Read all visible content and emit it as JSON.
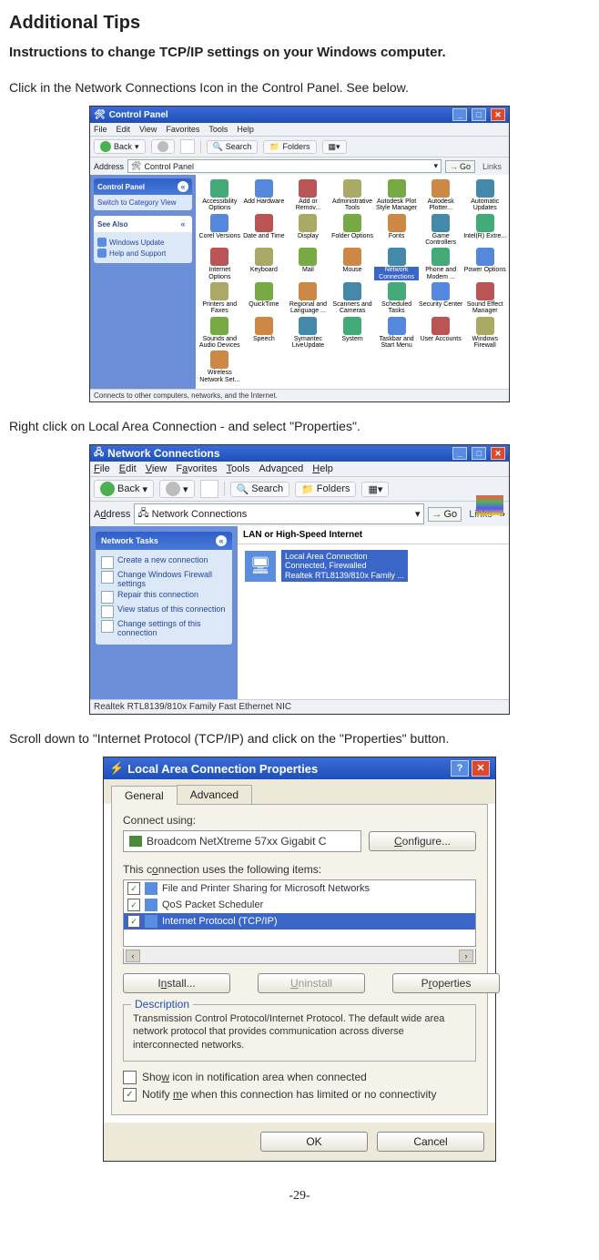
{
  "page": {
    "title": "Additional Tips",
    "subtitle": "Instructions to change TCP/IP settings on your Windows computer.",
    "step1": "Click in the Network Connections Icon in the Control Panel. See below.",
    "step2": "Right click on Local Area Connection - and select \"Properties\".",
    "step3": "Scroll down to \"Internet Protocol (TCP/IP) and click on the \"Properties\" button.",
    "page_number": "-29-"
  },
  "control_panel": {
    "title": "Control Panel",
    "menus": {
      "file": "File",
      "edit": "Edit",
      "view": "View",
      "favorites": "Favorites",
      "tools": "Tools",
      "help": "Help"
    },
    "toolbar": {
      "back": "Back",
      "search": "Search",
      "folders": "Folders"
    },
    "address_label": "Address",
    "address_value": "Control Panel",
    "go": "Go",
    "links": "Links",
    "side": {
      "header": "Control Panel",
      "switch": "Switch to Category View",
      "see_also": "See Also",
      "win_update": "Windows Update",
      "help": "Help and Support"
    },
    "items": [
      [
        "Accessibility Options",
        "Add Hardware",
        "Add or Remov...",
        "Administrative Tools",
        "Autodesk Plot Style Manager",
        "Autodesk Plotter...",
        "Automatic Updates"
      ],
      [
        "Corel Versions",
        "Date and Time",
        "Display",
        "Folder Options",
        "Fonts",
        "Game Controllers",
        "Intel(R) Extre..."
      ],
      [
        "Internet Options",
        "Keyboard",
        "Mail",
        "Mouse",
        "Network Connections",
        "Phone and Modem ...",
        "Power Options"
      ],
      [
        "Printers and Faxes",
        "QuickTime",
        "Regional and Language ...",
        "Scanners and Cameras",
        "Scheduled Tasks",
        "Security Center",
        "Sound Effect Manager"
      ],
      [
        "Sounds and Audio Devices",
        "Speech",
        "Symantec LiveUpdate",
        "System",
        "Taskbar and Start Menu",
        "User Accounts",
        "Windows Firewall"
      ],
      [
        "Wireless Network Set...",
        "",
        "",
        "",
        "",
        "",
        ""
      ]
    ],
    "selected": "Network Connections",
    "status": "Connects to other computers, networks, and the Internet."
  },
  "network_connections": {
    "title": "Network Connections",
    "menus": {
      "file": "File",
      "edit": "Edit",
      "view": "View",
      "favorites": "Favorites",
      "tools": "Tools",
      "advanced": "Advanced",
      "help": "Help"
    },
    "toolbar": {
      "back": "Back",
      "search": "Search",
      "folders": "Folders"
    },
    "address_label": "Address",
    "address_value": "Network Connections",
    "go": "Go",
    "links": "Links",
    "tasks_header": "Network Tasks",
    "tasks": [
      "Create a new connection",
      "Change Windows Firewall settings",
      "Repair this connection",
      "View status of this connection",
      "Change settings of this connection"
    ],
    "group": "LAN or High-Speed Internet",
    "conn_name": "Local Area Connection",
    "conn_status": "Connected, Firewalled",
    "conn_device": "Realtek RTL8139/810x Family ...",
    "status": "Realtek RTL8139/810x Family Fast Ethernet NIC"
  },
  "lac_properties": {
    "title": "Local Area Connection Properties",
    "tabs": {
      "general": "General",
      "advanced": "Advanced"
    },
    "connect_using": "Connect using:",
    "adapter": "Broadcom NetXtreme 57xx Gigabit C",
    "configure": "Configure...",
    "items_label": "This connection uses the following items:",
    "items": [
      "File and Printer Sharing for Microsoft Networks",
      "QoS Packet Scheduler",
      "Internet Protocol (TCP/IP)"
    ],
    "install": "Install...",
    "uninstall": "Uninstall",
    "properties": "Properties",
    "description_label": "Description",
    "description": "Transmission Control Protocol/Internet Protocol. The default wide area network protocol that provides communication across diverse interconnected networks.",
    "show_icon": "Show icon in notification area when connected",
    "notify": "Notify me when this connection has limited or no connectivity",
    "ok": "OK",
    "cancel": "Cancel"
  }
}
